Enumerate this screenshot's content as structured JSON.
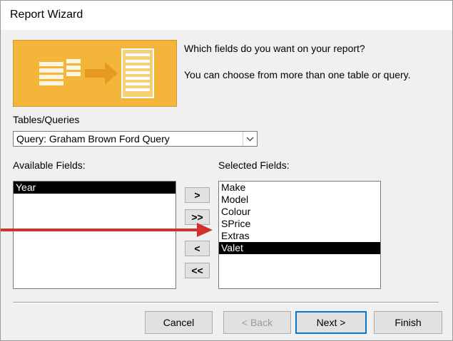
{
  "window": {
    "title": "Report Wizard"
  },
  "intro": {
    "question": "Which fields do you want on your report?",
    "hint": "You can choose from more than one table or query."
  },
  "tables_queries": {
    "label": "Tables/Queries",
    "selected": "Query: Graham Brown Ford Query"
  },
  "available_fields": {
    "label": "Available Fields:",
    "items": [
      "Year"
    ],
    "selected_index": 0
  },
  "selected_fields": {
    "label": "Selected Fields:",
    "items": [
      "Make",
      "Model",
      "Colour",
      "SPrice",
      "Extras",
      "Valet"
    ],
    "selected_index": 5
  },
  "move_buttons": {
    "add_one": ">",
    "add_all": ">>",
    "remove_one": "<",
    "remove_all": "<<"
  },
  "buttons": {
    "cancel": "Cancel",
    "back": "< Back",
    "next": "Next >",
    "finish": "Finish"
  },
  "colors": {
    "banner": "#f3b63a",
    "annotation_arrow": "#d32f2f",
    "default_button_border": "#0078d7"
  }
}
